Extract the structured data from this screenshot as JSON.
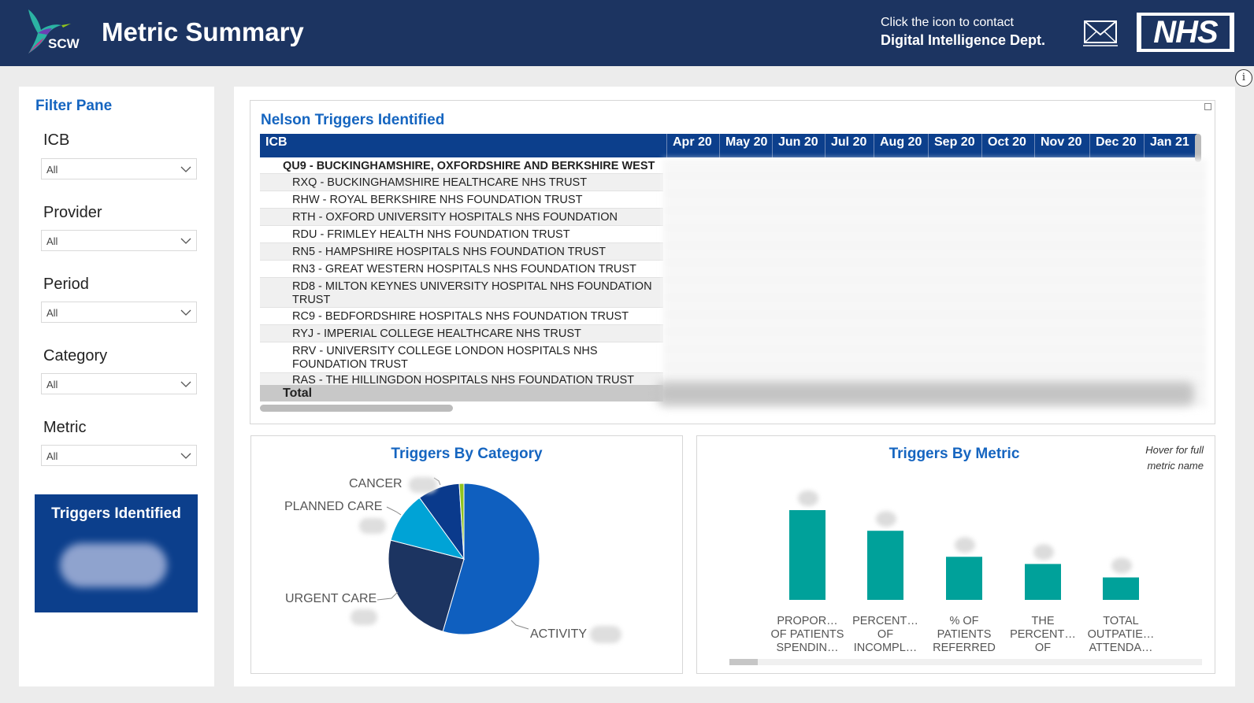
{
  "header": {
    "logo_text": "SCW",
    "title": "Metric Summary",
    "contact_line1": "Click the icon to contact",
    "contact_line2": "Digital Intelligence Dept.",
    "nhs_logo": "NHS",
    "info_icon": "i"
  },
  "filters": {
    "title": "Filter Pane",
    "items": [
      {
        "label": "ICB",
        "value": "All"
      },
      {
        "label": "Provider",
        "value": "All"
      },
      {
        "label": "Period",
        "value": "All"
      },
      {
        "label": "Category",
        "value": "All"
      },
      {
        "label": "Metric",
        "value": "All"
      }
    ],
    "kpi_title": "Triggers Identified"
  },
  "table": {
    "title": "Nelson Triggers Identified",
    "columns": [
      "ICB",
      "Apr 20",
      "May 20",
      "Jun 20",
      "Jul 20",
      "Aug 20",
      "Sep 20",
      "Oct 20",
      "Nov 20",
      "Dec 20",
      "Jan 21"
    ],
    "parent_row": "QU9 - BUCKINGHAMSHIRE, OXFORDSHIRE AND BERKSHIRE WEST",
    "rows": [
      "RXQ - BUCKINGHAMSHIRE HEALTHCARE NHS TRUST",
      "RHW - ROYAL BERKSHIRE NHS FOUNDATION TRUST",
      "RTH - OXFORD UNIVERSITY HOSPITALS NHS FOUNDATION",
      "RDU - FRIMLEY HEALTH NHS FOUNDATION TRUST",
      "RN5 - HAMPSHIRE HOSPITALS NHS FOUNDATION TRUST",
      "RN3 - GREAT WESTERN HOSPITALS NHS FOUNDATION TRUST",
      "RD8 - MILTON KEYNES UNIVERSITY HOSPITAL NHS FOUNDATION TRUST",
      "RC9 - BEDFORDSHIRE HOSPITALS NHS FOUNDATION TRUST",
      "RYJ - IMPERIAL COLLEGE HEALTHCARE NHS TRUST",
      "RRV - UNIVERSITY COLLEGE LONDON HOSPITALS NHS FOUNDATION TRUST",
      "RAS - THE HILLINGDON HOSPITALS NHS FOUNDATION TRUST"
    ],
    "total_label": "Total"
  },
  "pie": {
    "title": "Triggers By Category",
    "labels": [
      "CANCER",
      "PLANNED CARE",
      "URGENT CARE",
      "ACTIVITY"
    ]
  },
  "bar": {
    "title": "Triggers By Metric",
    "note_line1": "Hover for full",
    "note_line2": "metric name",
    "categories": [
      "PROPOR… OF PATIENTS SPENDIN…",
      "PERCENT… OF INCOMPL… PATHWAY…",
      "% OF PATIENTS REFERRED TO AN EM…",
      "THE PERCENT… OF PATIENTS…",
      "TOTAL OUTPATIE… ATTENDA… (ALL TFC…"
    ]
  },
  "colors": {
    "header_bg": "#1c3461",
    "accent_blue": "#1565c0",
    "table_header": "#0c3f8c",
    "bar_teal": "#00a19a",
    "pie_activity": "#0f5fbf",
    "pie_urgent": "#1c3461",
    "pie_planned": "#00a3d6",
    "pie_cancer": "#0a3a8c",
    "pie_small": "#8fc31f"
  },
  "chart_data": [
    {
      "type": "pie",
      "title": "Triggers By Category",
      "categories": [
        "ACTIVITY",
        "URGENT CARE",
        "PLANNED CARE",
        "CANCER",
        ""
      ],
      "values": [
        54.5,
        24.5,
        11,
        9,
        1
      ]
    },
    {
      "type": "bar",
      "title": "Triggers By Metric",
      "categories": [
        "PROPOR… OF PATIENTS SPENDIN…",
        "PERCENT… OF INCOMPL… PATHWAY…",
        "% OF PATIENTS REFERRED TO AN EM…",
        "THE PERCENT… OF PATIENTS…",
        "TOTAL OUTPATIE… ATTENDA… (ALL TFC…"
      ],
      "values": [
        100,
        77,
        48,
        40,
        25
      ]
    }
  ]
}
